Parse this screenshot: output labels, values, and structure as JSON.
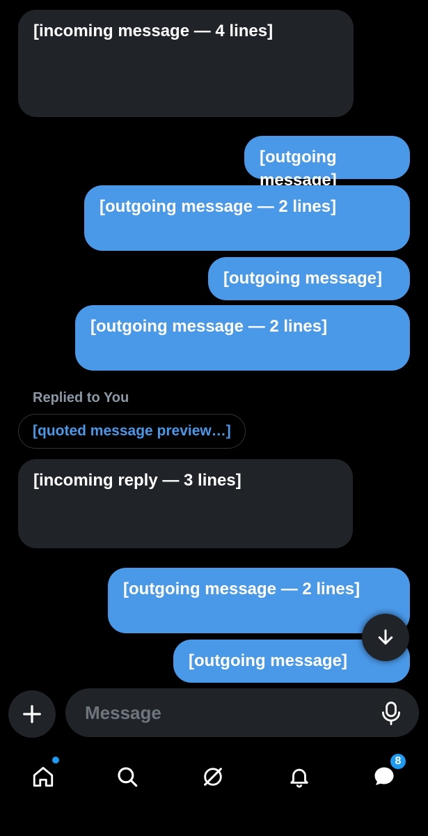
{
  "thread": {
    "messages": [
      {
        "dir": "in",
        "text": "[incoming message — 4 lines]"
      },
      {
        "dir": "out",
        "text": "[outgoing message]"
      },
      {
        "dir": "out",
        "text": "[outgoing message — 2 lines]"
      },
      {
        "dir": "out",
        "text": "[outgoing message]"
      },
      {
        "dir": "out",
        "text": "[outgoing message — 2 lines]"
      },
      {
        "dir": "in",
        "text": "[incoming reply — 3 lines]"
      },
      {
        "dir": "out",
        "text": "[outgoing message — 2 lines]"
      },
      {
        "dir": "out",
        "text": "[outgoing message]"
      }
    ],
    "reply": {
      "label": "Replied to You",
      "quote": "[quoted message preview…]"
    }
  },
  "composer": {
    "placeholder": "Message"
  },
  "nav": {
    "items": [
      "home-icon",
      "search-icon",
      "grok-icon",
      "notifications-icon",
      "messages-icon"
    ],
    "messages_badge": "8"
  },
  "colors": {
    "outgoing": "#4a99e9",
    "incoming": "#202327",
    "accent": "#1d9bf0"
  }
}
